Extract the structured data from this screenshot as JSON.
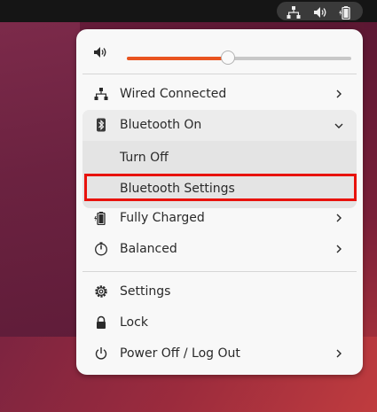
{
  "wallpaper": {
    "accent": "#6a1d3c"
  },
  "topbar": {
    "icons": [
      "network-wired-icon",
      "volume-icon",
      "battery-icon"
    ]
  },
  "menu": {
    "volume": {
      "level": 0.45,
      "icon": "volume-icon",
      "fill_color": "#e95420"
    },
    "items": {
      "wired": {
        "label": "Wired Connected",
        "icon": "network-wired-icon"
      },
      "bluetooth": {
        "label": "Bluetooth On",
        "icon": "bluetooth-icon",
        "expanded": true,
        "sub": [
          {
            "label": "Turn Off"
          },
          {
            "label": "Bluetooth Settings"
          }
        ]
      },
      "battery": {
        "label": "Fully Charged",
        "icon": "battery-charging-icon"
      },
      "power_mode": {
        "label": "Balanced",
        "icon": "power-mode-icon"
      },
      "settings": {
        "label": "Settings",
        "icon": "gear-icon"
      },
      "lock": {
        "label": "Lock",
        "icon": "lock-icon"
      },
      "power": {
        "label": "Power Off / Log Out",
        "icon": "power-icon"
      }
    },
    "highlight_color": "#e8120c"
  }
}
